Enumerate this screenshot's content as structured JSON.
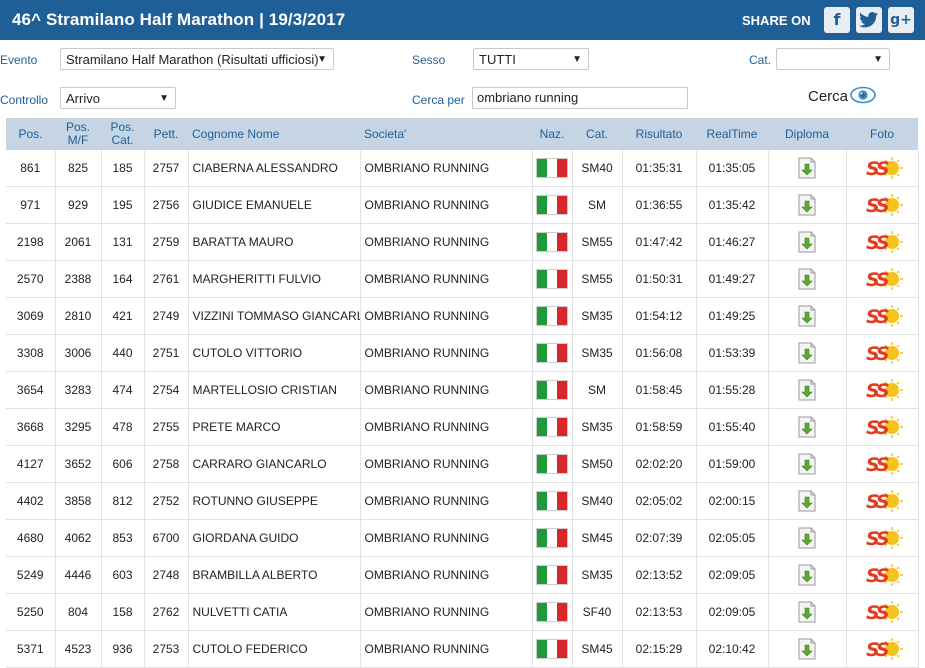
{
  "header": {
    "title": "46^ Stramilano Half Marathon  |  19/3/2017",
    "share_label": "SHARE ON",
    "share_icons": [
      "facebook-icon",
      "twitter-icon",
      "google-plus-icon"
    ]
  },
  "filters": {
    "evento_label": "Evento",
    "evento_value": "Stramilano Half Marathon (Risultati ufficiosi)",
    "sesso_label": "Sesso",
    "sesso_value": "TUTTI",
    "cat_label": "Cat.",
    "cat_value": "",
    "controllo_label": "Controllo",
    "controllo_value": "Arrivo",
    "cerca_per_label": "Cerca per",
    "cerca_per_value": "ombriano running",
    "cerca_label": "Cerca"
  },
  "table": {
    "headers": [
      "Pos.",
      "Pos. M/F",
      "Pos. Cat.",
      "Pett.",
      "Cognome Nome",
      "Societa'",
      "Naz.",
      "Cat.",
      "Risultato",
      "RealTime",
      "Diploma",
      "Foto"
    ],
    "rows": [
      {
        "pos": "861",
        "posmf": "825",
        "poscat": "185",
        "pett": "2757",
        "nome": "CIABERNA ALESSANDRO",
        "soc": "OMBRIANO RUNNING",
        "cat": "SM40",
        "ris": "01:35:31",
        "real": "01:35:05"
      },
      {
        "pos": "971",
        "posmf": "929",
        "poscat": "195",
        "pett": "2756",
        "nome": "GIUDICE EMANUELE",
        "soc": "OMBRIANO RUNNING",
        "cat": "SM",
        "ris": "01:36:55",
        "real": "01:35:42"
      },
      {
        "pos": "2198",
        "posmf": "2061",
        "poscat": "131",
        "pett": "2759",
        "nome": "BARATTA MAURO",
        "soc": "OMBRIANO RUNNING",
        "cat": "SM55",
        "ris": "01:47:42",
        "real": "01:46:27"
      },
      {
        "pos": "2570",
        "posmf": "2388",
        "poscat": "164",
        "pett": "2761",
        "nome": "MARGHERITTI FULVIO",
        "soc": "OMBRIANO RUNNING",
        "cat": "SM55",
        "ris": "01:50:31",
        "real": "01:49:27"
      },
      {
        "pos": "3069",
        "posmf": "2810",
        "poscat": "421",
        "pett": "2749",
        "nome": "VIZZINI TOMMASO GIANCARLO",
        "soc": "OMBRIANO RUNNING",
        "cat": "SM35",
        "ris": "01:54:12",
        "real": "01:49:25"
      },
      {
        "pos": "3308",
        "posmf": "3006",
        "poscat": "440",
        "pett": "2751",
        "nome": "CUTOLO VITTORIO",
        "soc": "OMBRIANO RUNNING",
        "cat": "SM35",
        "ris": "01:56:08",
        "real": "01:53:39"
      },
      {
        "pos": "3654",
        "posmf": "3283",
        "poscat": "474",
        "pett": "2754",
        "nome": "MARTELLOSIO CRISTIAN",
        "soc": "OMBRIANO RUNNING",
        "cat": "SM",
        "ris": "01:58:45",
        "real": "01:55:28"
      },
      {
        "pos": "3668",
        "posmf": "3295",
        "poscat": "478",
        "pett": "2755",
        "nome": "PRETE MARCO",
        "soc": "OMBRIANO RUNNING",
        "cat": "SM35",
        "ris": "01:58:59",
        "real": "01:55:40"
      },
      {
        "pos": "4127",
        "posmf": "3652",
        "poscat": "606",
        "pett": "2758",
        "nome": "CARRARO GIANCARLO",
        "soc": "OMBRIANO RUNNING",
        "cat": "SM50",
        "ris": "02:02:20",
        "real": "01:59:00"
      },
      {
        "pos": "4402",
        "posmf": "3858",
        "poscat": "812",
        "pett": "2752",
        "nome": "ROTUNNO GIUSEPPE",
        "soc": "OMBRIANO RUNNING",
        "cat": "SM40",
        "ris": "02:05:02",
        "real": "02:00:15"
      },
      {
        "pos": "4680",
        "posmf": "4062",
        "poscat": "853",
        "pett": "6700",
        "nome": "GIORDANA GUIDO",
        "soc": "OMBRIANO RUNNING",
        "cat": "SM45",
        "ris": "02:07:39",
        "real": "02:05:05"
      },
      {
        "pos": "5249",
        "posmf": "4446",
        "poscat": "603",
        "pett": "2748",
        "nome": "BRAMBILLA ALBERTO",
        "soc": "OMBRIANO RUNNING",
        "cat": "SM35",
        "ris": "02:13:52",
        "real": "02:09:05"
      },
      {
        "pos": "5250",
        "posmf": "804",
        "poscat": "158",
        "pett": "2762",
        "nome": "NULVETTI CATIA",
        "soc": "OMBRIANO RUNNING",
        "cat": "SF40",
        "ris": "02:13:53",
        "real": "02:09:05"
      },
      {
        "pos": "5371",
        "posmf": "4523",
        "poscat": "936",
        "pett": "2753",
        "nome": "CUTOLO FEDERICO",
        "soc": "OMBRIANO RUNNING",
        "cat": "SM45",
        "ris": "02:15:29",
        "real": "02:10:42"
      }
    ],
    "nationality_icon": "italy-flag-icon",
    "diploma_icon": "download-document-icon",
    "foto_icon": "sportograf-logo-icon",
    "foto_logo_text": "SS"
  },
  "colors": {
    "header_bg": "#1f5f97",
    "table_header_bg": "#c5d5e4",
    "label_blue": "#1f5f97",
    "flag_green": "#1f9a3a",
    "flag_red": "#d7272c"
  }
}
